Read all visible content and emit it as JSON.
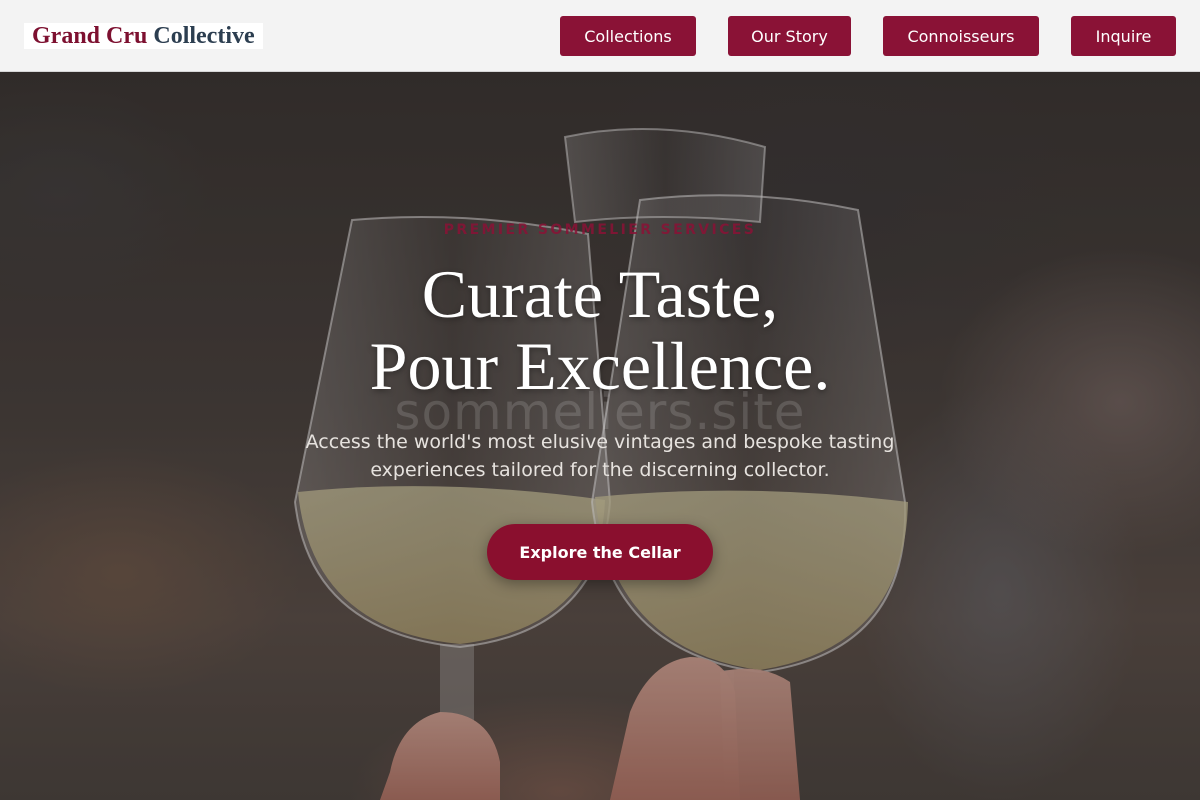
{
  "brand": {
    "name_part1": "Grand Cru",
    "name_part2": "Collective",
    "colors": {
      "primary": "#8a1236",
      "logo_slate": "#2c3e50"
    }
  },
  "nav": {
    "items": [
      {
        "label": "Collections"
      },
      {
        "label": "Our Story"
      },
      {
        "label": "Connoisseurs"
      },
      {
        "label": "Inquire"
      }
    ]
  },
  "hero": {
    "eyebrow": "PREMIER SOMMELIER SERVICES",
    "headline_line1": "Curate Taste,",
    "headline_line2": "Pour Excellence.",
    "background_watermark": "sommeliers.site",
    "subtitle": "Access the world's most elusive vintages and bespoke tasting experiences tailored for the discerning collector.",
    "cta_label": "Explore the Cellar"
  }
}
